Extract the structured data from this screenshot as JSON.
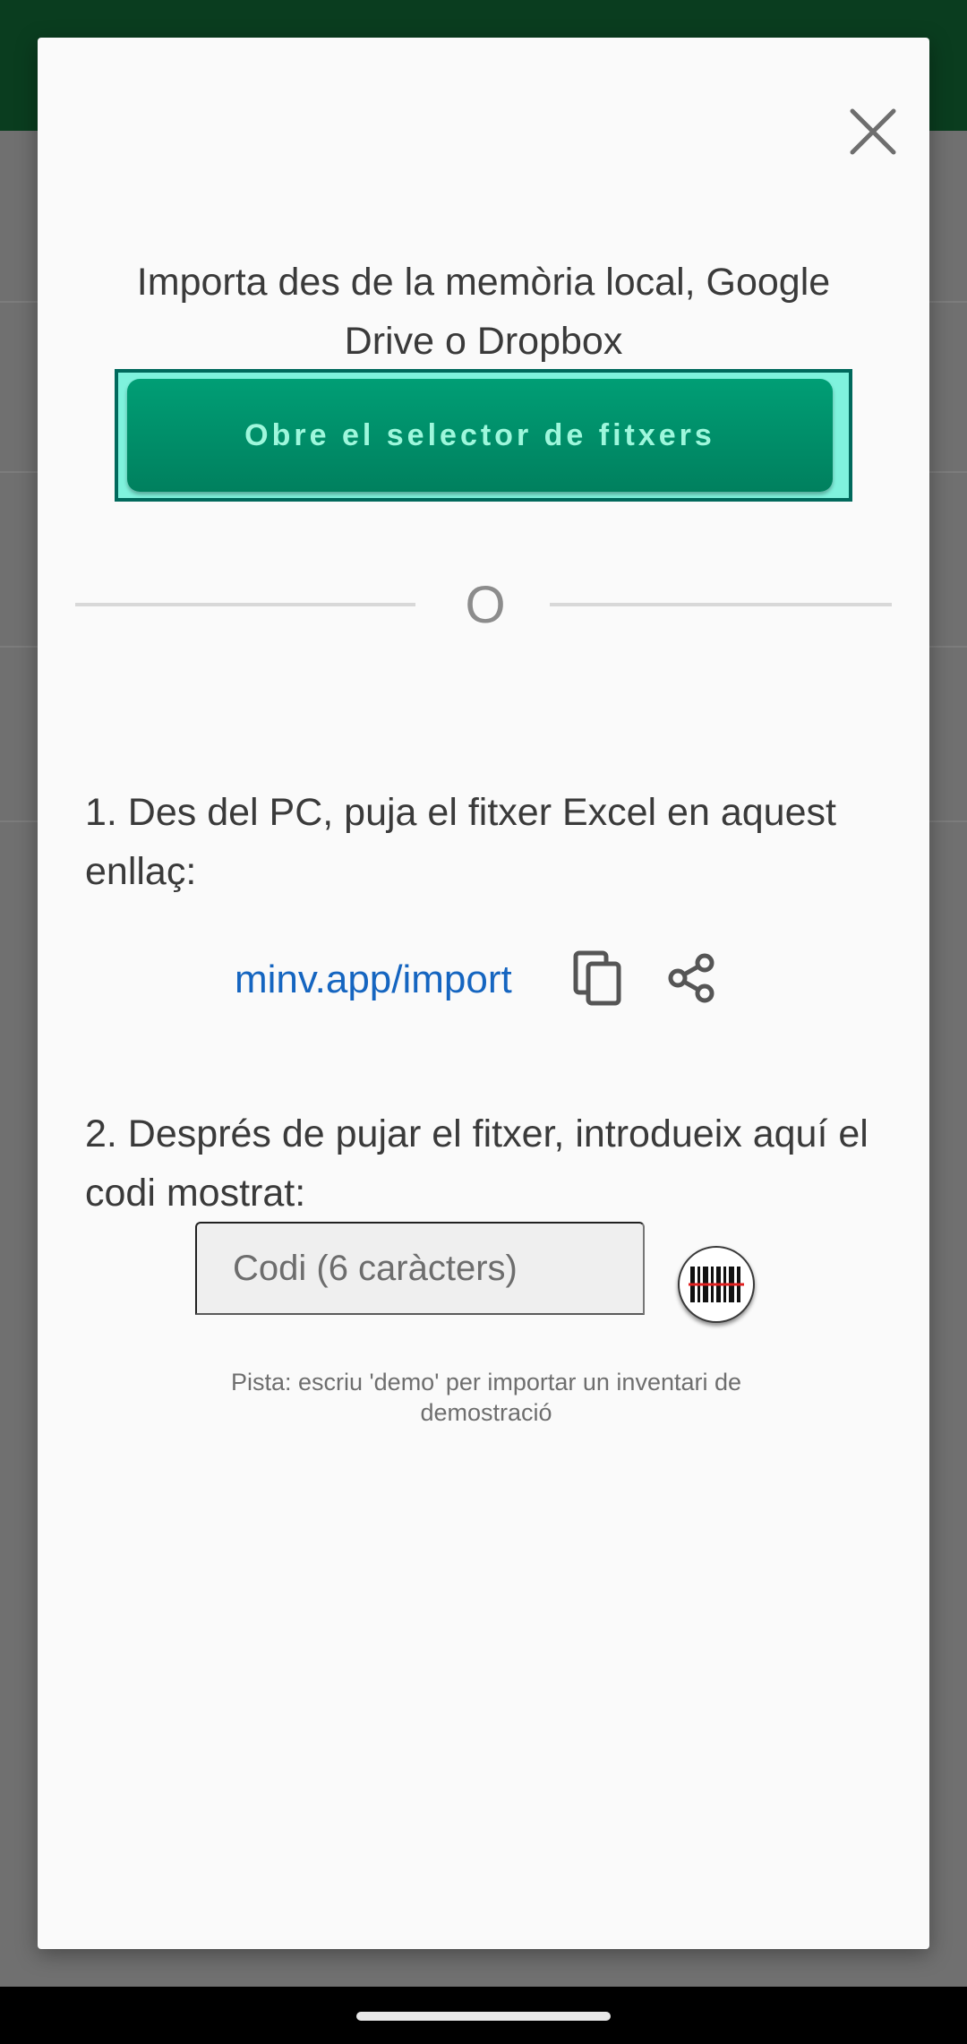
{
  "dialog": {
    "heading": "Importa des de la memòria local, Google Drive o Dropbox",
    "picker_button_label": "Obre el selector de fitxers",
    "divider_text": "O",
    "step1": "1. Des del PC, puja el fitxer Excel en aquest enllaç:",
    "link_text": "minv.app/import",
    "step2": "2. Després de pujar el fitxer, introdueix aquí el codi mostrat:",
    "code_placeholder": "Codi (6 caràcters)",
    "code_value": "",
    "hint": "Pista: escriu 'demo' per importar un inventari de demostració"
  },
  "icons": {
    "close": "close-icon",
    "copy": "copy-icon",
    "share": "share-icon",
    "barcode": "barcode-scan-icon"
  },
  "colors": {
    "status_bar": "#0a3d1f",
    "primary_button": "#00805e",
    "button_text": "#9ef7dc",
    "focus_outline": "#7ff2dd",
    "link": "#1565c0"
  }
}
